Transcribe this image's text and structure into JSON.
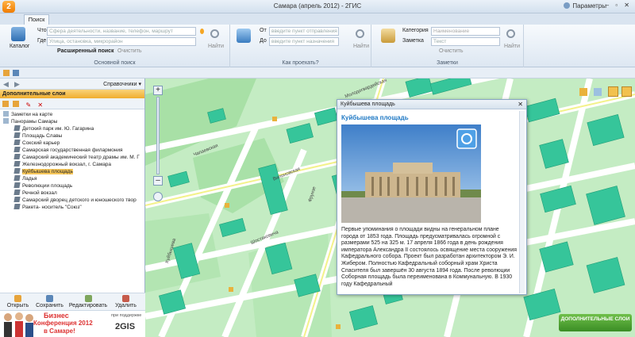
{
  "window": {
    "title": "Самара (апрель 2012) - 2ГИС",
    "params_label": "Параметры",
    "controls": "–  ▫  ✕"
  },
  "tabs": {
    "search": "Поиск"
  },
  "ribbon": {
    "catalog_label": "Каталог",
    "what_label": "Что",
    "what_placeholder": "Сфера деятельности, название, телефон, маршрут",
    "where_label": "Где",
    "where_placeholder": "Улица, остановка, микрорайон",
    "find_label": "Найти",
    "advanced_label": "Расширенный поиск",
    "clear_label": "Очистить",
    "basic_group": "Основной поиск",
    "from_label": "От",
    "from_placeholder": "введите пункт отправления",
    "to_label": "До",
    "to_placeholder": "введите пункт назначения",
    "route_group": "Как проехать?",
    "category_label": "Категория",
    "category_value": "Наименование",
    "note_label": "Заметка",
    "note_value": "Текст",
    "notes_group": "Заметки",
    "notes_clear": "Очистить",
    "notes_find": "Найти"
  },
  "left_panel": {
    "directories": "Справочники ▾",
    "layers_header": "Дополнительные слои",
    "tree": [
      {
        "label": "Заметки на карте",
        "level": 0
      },
      {
        "label": "Панорамы Самары",
        "level": 0
      },
      {
        "label": "Детский парк им. Ю. Гагарина",
        "level": 1
      },
      {
        "label": "Площадь Славы",
        "level": 1
      },
      {
        "label": "Сокский карьер",
        "level": 1
      },
      {
        "label": "Самарская государственная филармония",
        "level": 1
      },
      {
        "label": "Самарский академический театр драмы им. М. Г",
        "level": 1
      },
      {
        "label": "Железнодорожный вокзал, г. Самара",
        "level": 1
      },
      {
        "label": "Куйбышева площадь",
        "level": 1,
        "selected": true
      },
      {
        "label": "Ладья",
        "level": 1
      },
      {
        "label": "Революции площадь",
        "level": 1
      },
      {
        "label": "Речной вокзал",
        "level": 1
      },
      {
        "label": "Самарский дворец детского и юношеского твор",
        "level": 1
      },
      {
        "label": "Ракета- носитель \"Союз\"",
        "level": 1
      }
    ],
    "actions": {
      "open": "Открыть",
      "save": "Сохранить",
      "edit": "Редактировать",
      "delete": "Удалить"
    },
    "ad": {
      "line1": "Бизнес",
      "line2": "Конференция 2012",
      "line3": "в Самаре!",
      "support": "при поддержке",
      "brand": "2GIS"
    }
  },
  "map": {
    "streets": [
      "Молодогвардейская",
      "Фрунзе",
      "Чапаевская",
      "Вилоновская",
      "Шостаковича",
      "Куйбышева"
    ],
    "layers_button": "ДОПОЛНИТЕЛЬНЫЕ СЛОИ"
  },
  "popup": {
    "window_title": "Куйбышева площадь",
    "heading": "Куйбышева площадь",
    "text": "Первые упоминания о площади видны на генеральном плане города от 1853 года. Площадь предусматривалась огромной с размерами 525 на 325 м. 17 апреля 1866 года в день рождения императора Александра II состоялось освящение места сооружения Кафедрального собора. Проект был разработан архитектором Э. И. Жибером. Полностью Кафедральный соборный храм Христа Спасителя был завершён 30 августа 1894 года. После революции Соборная площадь была переименована в Коммунальную. В 1930 году Кафедральный"
  },
  "colors": {
    "accent": "#f0ad2d",
    "map_bg": "#c7eec6",
    "building": "#36c59a",
    "link": "#1e78c4"
  }
}
